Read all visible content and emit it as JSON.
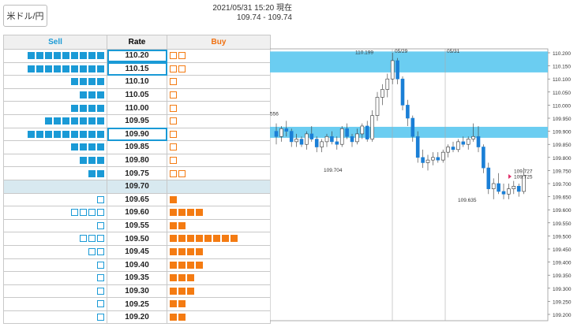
{
  "pair_button": "米ドル/円",
  "header": {
    "datetime": "2021/05/31 15:20 現在",
    "range": "109.74 - 109.74"
  },
  "columns": {
    "sell": "Sell",
    "rate": "Rate",
    "buy": "Buy"
  },
  "rows": [
    {
      "rate": "110.20",
      "sell": 9,
      "sell_filled": true,
      "buy": 2,
      "buy_filled": false,
      "hl": true
    },
    {
      "rate": "110.15",
      "sell": 9,
      "sell_filled": true,
      "buy": 2,
      "buy_filled": false,
      "hl": true
    },
    {
      "rate": "110.10",
      "sell": 4,
      "sell_filled": true,
      "buy": 1,
      "buy_filled": false,
      "hl": false
    },
    {
      "rate": "110.05",
      "sell": 3,
      "sell_filled": true,
      "buy": 1,
      "buy_filled": false,
      "hl": false
    },
    {
      "rate": "110.00",
      "sell": 4,
      "sell_filled": true,
      "buy": 1,
      "buy_filled": false,
      "hl": false
    },
    {
      "rate": "109.95",
      "sell": 7,
      "sell_filled": true,
      "buy": 1,
      "buy_filled": false,
      "hl": false
    },
    {
      "rate": "109.90",
      "sell": 9,
      "sell_filled": true,
      "buy": 1,
      "buy_filled": false,
      "hl": true
    },
    {
      "rate": "109.85",
      "sell": 4,
      "sell_filled": true,
      "buy": 1,
      "buy_filled": false,
      "hl": false
    },
    {
      "rate": "109.80",
      "sell": 3,
      "sell_filled": true,
      "buy": 1,
      "buy_filled": false,
      "hl": false
    },
    {
      "rate": "109.75",
      "sell": 2,
      "sell_filled": true,
      "buy": 2,
      "buy_filled": false,
      "hl": false
    },
    {
      "rate": "109.70",
      "sell": 0,
      "sell_filled": true,
      "buy": 0,
      "buy_filled": true,
      "hl": false,
      "current": true
    },
    {
      "rate": "109.65",
      "sell": 1,
      "sell_filled": false,
      "buy": 1,
      "buy_filled": true,
      "hl": false
    },
    {
      "rate": "109.60",
      "sell": 4,
      "sell_filled": false,
      "buy": 4,
      "buy_filled": true,
      "hl": false
    },
    {
      "rate": "109.55",
      "sell": 1,
      "sell_filled": false,
      "buy": 2,
      "buy_filled": true,
      "hl": false
    },
    {
      "rate": "109.50",
      "sell": 3,
      "sell_filled": false,
      "buy": 8,
      "buy_filled": true,
      "hl": false
    },
    {
      "rate": "109.45",
      "sell": 2,
      "sell_filled": false,
      "buy": 4,
      "buy_filled": true,
      "hl": false
    },
    {
      "rate": "109.40",
      "sell": 1,
      "sell_filled": false,
      "buy": 4,
      "buy_filled": true,
      "hl": false
    },
    {
      "rate": "109.35",
      "sell": 1,
      "sell_filled": false,
      "buy": 3,
      "buy_filled": true,
      "hl": false
    },
    {
      "rate": "109.30",
      "sell": 1,
      "sell_filled": false,
      "buy": 3,
      "buy_filled": true,
      "hl": false
    },
    {
      "rate": "109.25",
      "sell": 1,
      "sell_filled": false,
      "buy": 2,
      "buy_filled": true,
      "hl": false
    },
    {
      "rate": "109.20",
      "sell": 1,
      "sell_filled": false,
      "buy": 2,
      "buy_filled": true,
      "hl": false
    }
  ],
  "chart": {
    "y_labels": [
      "110.200",
      "110.150",
      "110.100",
      "110.050",
      "110.000",
      "109.950",
      "109.900",
      "109.850",
      "109.800",
      "109.750",
      "109.700",
      "109.650",
      "109.600",
      "109.550",
      "109.500",
      "109.450",
      "109.400",
      "109.350",
      "109.300",
      "109.250",
      "109.200"
    ],
    "date_labels": [
      "05/29",
      "05/31"
    ],
    "annotations": {
      "high": "110.199",
      "left_label": "556",
      "low1": "109.704",
      "low2": "109.635",
      "price_ask": "109.727",
      "price_bid": "109.725"
    },
    "colors": {
      "band": "#5bc8f0",
      "up": "#ffffff",
      "down": "#1a7fd6",
      "ask": "#e0306a",
      "bid": "#1a9ad6"
    }
  }
}
